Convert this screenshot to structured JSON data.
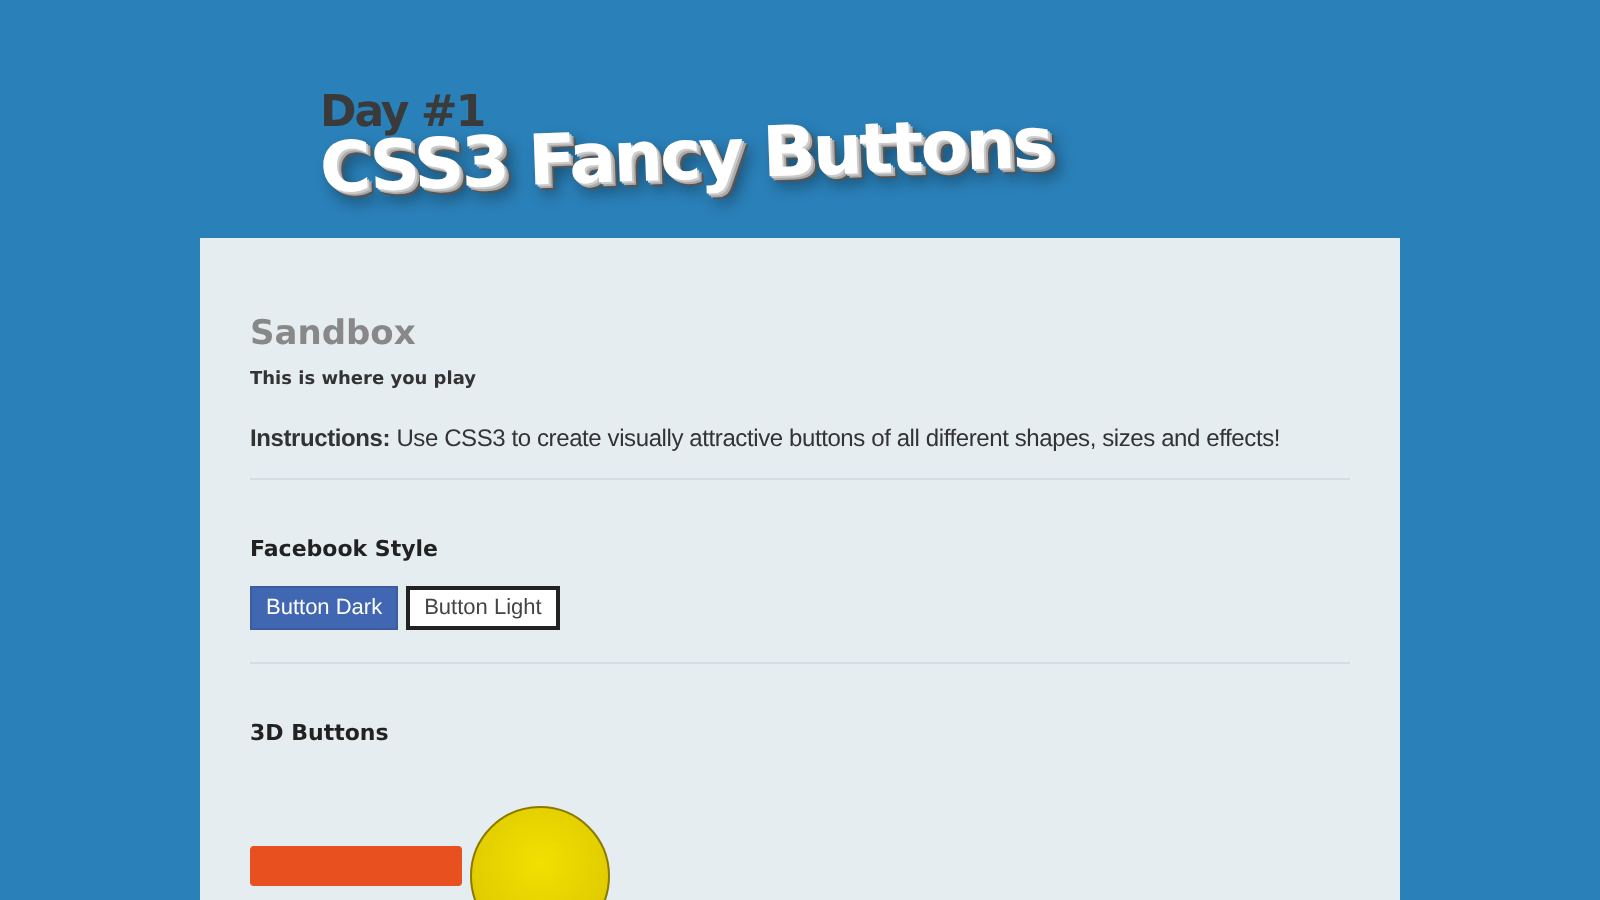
{
  "header": {
    "subtitle": "Day #1",
    "title": "CSS3 Fancy Buttons"
  },
  "sandbox": {
    "title": "Sandbox",
    "subtitle": "This is where you play",
    "instructions": "**Instructions:** Use CSS3 to create visually attractive buttons of all different shapes, sizes and effects!"
  },
  "sections": [
    {
      "title": "Facebook Style",
      "buttons": [
        {
          "kind": "dark",
          "label": "Button Dark"
        },
        {
          "kind": "light",
          "label": "Button Light"
        }
      ]
    },
    {
      "title": "3D Buttons",
      "buttons": [
        {
          "kind": "orange-bar"
        },
        {
          "kind": "yellow-circle"
        }
      ]
    }
  ]
}
